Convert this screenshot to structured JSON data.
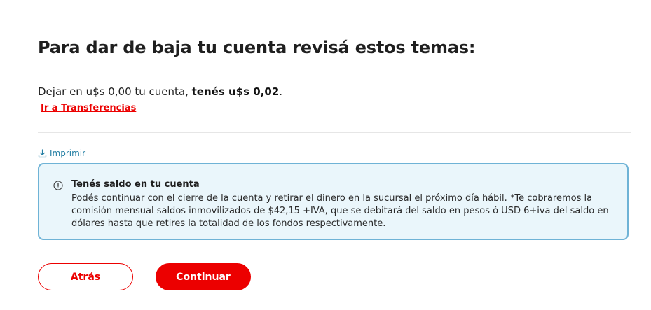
{
  "page": {
    "title": "Para dar de baja tu cuenta revisá estos temas:"
  },
  "requirement": {
    "text_prefix": "Dejar en u$s 0,00 tu cuenta, ",
    "text_strong": "tenés u$s 0,02",
    "text_suffix": ".",
    "link_label": "Ir a Transferencias"
  },
  "print": {
    "icon": "download-icon",
    "label": "Imprimir"
  },
  "notice": {
    "icon": "info-icon",
    "title": "Tenés saldo en tu cuenta",
    "body": "Podés continuar con el cierre de la cuenta y retirar el dinero en la sucursal el próximo día hábil. *Te cobraremos la comisión mensual saldos inmovilizados de $42,15 +IVA, que se debitará del saldo en pesos ó USD 6+iva del saldo en dólares hasta que retires la totalidad de los fondos respectivamente."
  },
  "actions": {
    "back_label": "Atrás",
    "continue_label": "Continuar"
  },
  "colors": {
    "brand_red": "#ec0000",
    "info_border": "#6fb3d6",
    "info_background": "#eaf6fb",
    "link_blue": "#257fa4"
  }
}
